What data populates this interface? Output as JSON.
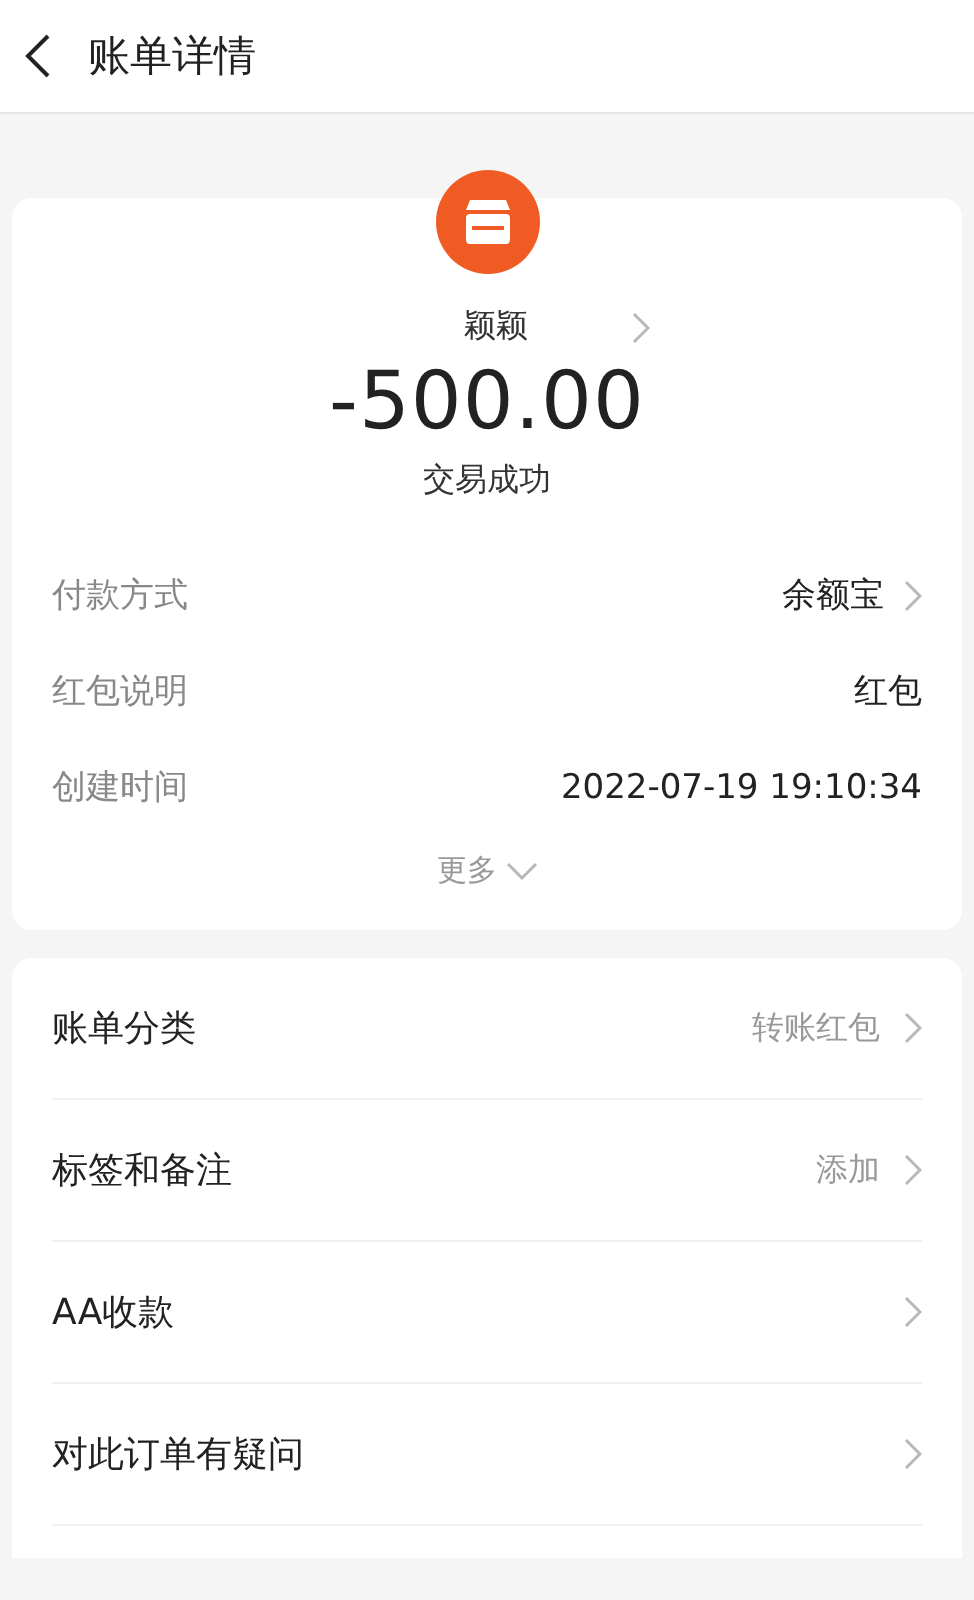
{
  "header": {
    "title": "账单详情"
  },
  "summary": {
    "name": "颖颖",
    "amount": "-500.00",
    "status": "交易成功",
    "details": [
      {
        "label": "付款方式",
        "value": "余额宝",
        "has_arrow": true
      },
      {
        "label": "红包说明",
        "value": "红包",
        "has_arrow": false
      },
      {
        "label": "创建时间",
        "value": "2022-07-19 19:10:34",
        "has_arrow": false
      }
    ],
    "more": "更多"
  },
  "actions": [
    {
      "label": "账单分类",
      "value": "转账红包"
    },
    {
      "label": "标签和备注",
      "value": "添加"
    },
    {
      "label": "AA收款"
    },
    {
      "label": "对此订单有疑问"
    }
  ]
}
